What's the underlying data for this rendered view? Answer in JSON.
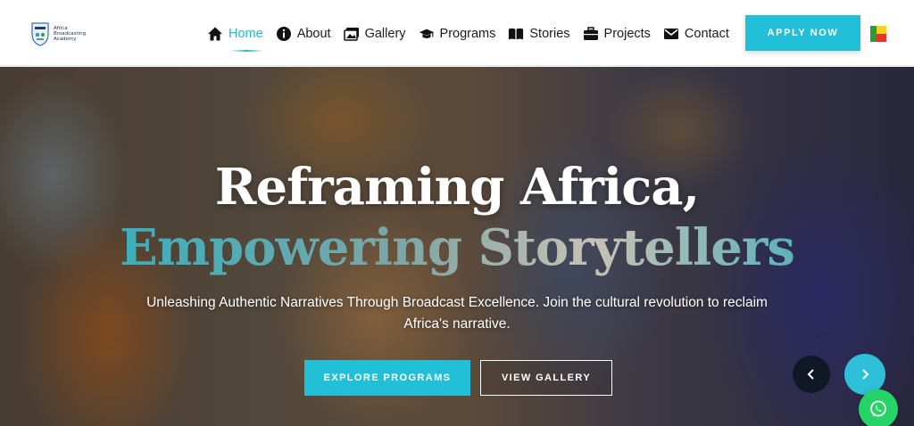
{
  "header": {
    "logo": {
      "line1": "Africa",
      "line2": "Broadcasting",
      "line3": "Academy"
    },
    "nav": [
      {
        "label": "Home",
        "icon": "home-icon",
        "active": true
      },
      {
        "label": "About",
        "icon": "info-icon",
        "active": false
      },
      {
        "label": "Gallery",
        "icon": "images-icon",
        "active": false
      },
      {
        "label": "Programs",
        "icon": "graduation-cap-icon",
        "active": false
      },
      {
        "label": "Stories",
        "icon": "book-icon",
        "active": false
      },
      {
        "label": "Projects",
        "icon": "briefcase-icon",
        "active": false
      },
      {
        "label": "Contact",
        "icon": "envelope-icon",
        "active": false
      }
    ],
    "apply_label": "APPLY NOW",
    "flag": "benin-flag-icon"
  },
  "hero": {
    "title_line1": "Reframing Africa,",
    "title_line2": "Empowering Storytellers",
    "subtitle": "Unleashing Authentic Narratives Through Broadcast Excellence. Join the cultural revolution to reclaim Africa's narrative.",
    "explore_label": "EXPLORE PROGRAMS",
    "gallery_label": "VIEW GALLERY"
  },
  "colors": {
    "accent": "#22bfd8",
    "nav_text": "#1b1b1b",
    "whatsapp": "#25d366"
  }
}
